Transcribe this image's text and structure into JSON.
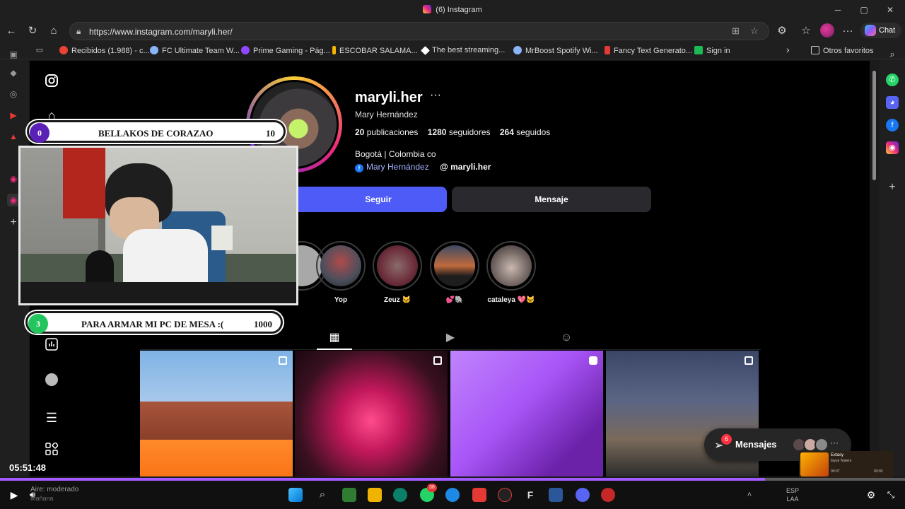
{
  "window": {
    "title": "(6) Instagram",
    "minimize": "─",
    "maximize": "▢",
    "close": "✕"
  },
  "nav": {
    "back": "←",
    "reload": "↻",
    "home": "⌂",
    "url": "https://www.instagram.com/maryli.her/",
    "chat_label": "Chat",
    "more": "···"
  },
  "bookmarks": [
    {
      "label": "Recibidos (1.988) - c...",
      "icon": "gmail-icon",
      "color": "#ea4335"
    },
    {
      "label": "FC Ultimate Team W...",
      "icon": "globe-icon",
      "color": "#8ab4f8"
    },
    {
      "label": "Prime Gaming - Pág...",
      "icon": "prime-gaming-icon",
      "color": "#9146ff"
    },
    {
      "label": "ESCOBAR SALAMA...",
      "icon": "bookmark-icon",
      "color": "#f4b400"
    },
    {
      "label": "The best streaming...",
      "icon": "diamond-icon",
      "color": "#ffffff"
    },
    {
      "label": "MrBoost Spotify Wi...",
      "icon": "globe-icon",
      "color": "#8ab4f8"
    },
    {
      "label": "Fancy Text Generato...",
      "icon": "fancy-text-icon",
      "color": "#e53935"
    },
    {
      "label": "Sign in",
      "icon": "signin-icon",
      "color": "#1db954"
    }
  ],
  "bookmarks_more": "›",
  "bookmarks_other": "Otros favoritos",
  "profile": {
    "username": "maryli.her",
    "more": "···",
    "full_name": "Mary Hernández",
    "posts_count": "20",
    "posts_label": "publicaciones",
    "followers_count": "1280",
    "followers_label": "seguidores",
    "following_count": "264",
    "following_label": "seguidos",
    "bio": "Bogotá | Colombia co",
    "fb_link": "Mary Hernández",
    "threads_link": "maryli.her",
    "follow_label": "Seguir",
    "message_label": "Mensaje"
  },
  "highlights": [
    {
      "label": "Yop",
      "color": "#4a4e5c"
    },
    {
      "label": "Zeuz 🐱",
      "color": "#6b2d3a"
    },
    {
      "label": "💕🐘",
      "color": "#c06a3c"
    },
    {
      "label": "cataleya 💖🐱",
      "color": "#7b6e6a"
    }
  ],
  "overlay": {
    "top_bar": {
      "count": "0",
      "text": "BELLAKOS DE CORAZAO",
      "goal": "10",
      "circle_color": "#5b21b6"
    },
    "bottom_bar": {
      "count": "3",
      "text": "PARA ARMAR MI PC DE MESA :(",
      "goal": "1000",
      "circle_color": "#22c55e"
    }
  },
  "messages": {
    "badge": "6",
    "label": "Mensajes",
    "more": "···"
  },
  "music": {
    "title": "Extasy",
    "artist": "bryce Towers",
    "elapsed": "00:37",
    "total": "03:03"
  },
  "player": {
    "time": "05:51:48",
    "progress": 0.845,
    "volume_icon": "volume-icon",
    "play_icon": "play-icon"
  },
  "taskbar": {
    "weather_line1": "Aire: moderado",
    "weather_line2": "Mañana",
    "lang1": "ESP",
    "lang2": "LAA",
    "whatsapp_badge": "38"
  }
}
